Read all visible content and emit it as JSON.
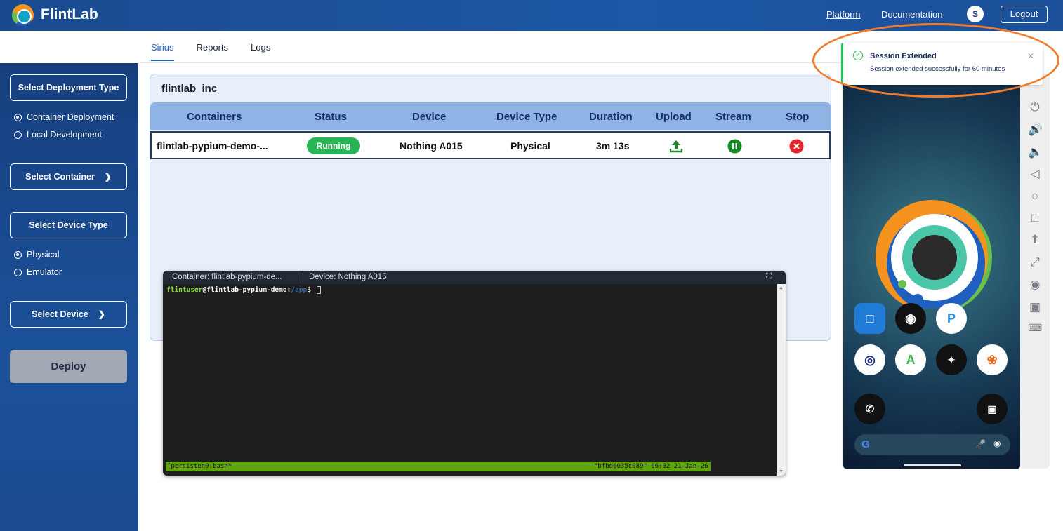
{
  "header": {
    "brand": "FlintLab",
    "nav": {
      "platform": "Platform",
      "documentation": "Documentation"
    },
    "avatar_initial": "S",
    "logout": "Logout"
  },
  "tabs": [
    {
      "label": "Sirius",
      "active": true
    },
    {
      "label": "Reports",
      "active": false
    },
    {
      "label": "Logs",
      "active": false
    }
  ],
  "sidebar": {
    "deployment_type_label": "Select Deployment Type",
    "deployment_options": [
      {
        "label": "Container Deployment",
        "selected": true
      },
      {
        "label": "Local Development",
        "selected": false
      }
    ],
    "select_container": "Select Container",
    "device_type_label": "Select Device Type",
    "device_type_options": [
      {
        "label": "Physical",
        "selected": true
      },
      {
        "label": "Emulator",
        "selected": false
      }
    ],
    "select_device": "Select Device",
    "deploy_button": "Deploy"
  },
  "containers_panel": {
    "org_name": "flintlab_inc",
    "columns": [
      "Containers",
      "Status",
      "Device",
      "Device Type",
      "Duration",
      "Upload",
      "Stream",
      "Stop"
    ],
    "rows": [
      {
        "container": "flintlab-pypium-demo-...",
        "status": "Running",
        "device": "Nothing A015",
        "device_type": "Physical",
        "duration": "3m 13s"
      }
    ]
  },
  "terminal": {
    "container_label": "Container:  flintlab-pypium-de...",
    "device_label": "Device:  Nothing A015",
    "prompt_user": "flintuser",
    "prompt_host": "@flintlab-pypium-demo:",
    "prompt_path": "/app",
    "prompt_suffix": "$ ",
    "status_left": "[persisten0:bash*",
    "status_right": "\"bfbd6035c089\" 06:02 21-Jan-26"
  },
  "toast": {
    "title": "Session Extended",
    "message": "Session extended successfully for 60 minutes"
  },
  "device_controls": [
    "power-icon",
    "volume-up-icon",
    "volume-down-icon",
    "back-icon",
    "home-icon",
    "overview-icon",
    "upload-icon",
    "expand-icon",
    "record-icon",
    "camera-icon",
    "keyboard-icon"
  ],
  "colors": {
    "running_badge": "#26b457",
    "table_header": "#8fb3e4",
    "toast_accent": "#2dbd5d",
    "highlight_ring": "#f07c2c"
  }
}
